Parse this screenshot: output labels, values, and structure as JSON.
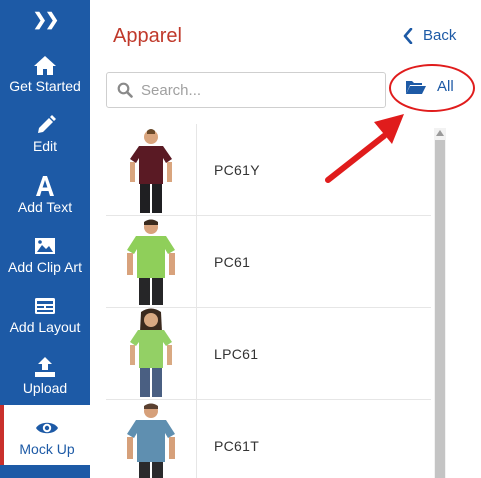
{
  "sidebar": {
    "items": [
      {
        "label": "Get Started",
        "icon": "home-icon"
      },
      {
        "label": "Edit",
        "icon": "pencil-icon"
      },
      {
        "label": "Add Text",
        "icon": "text-a-icon"
      },
      {
        "label": "Add Clip Art",
        "icon": "image-icon"
      },
      {
        "label": "Add Layout",
        "icon": "layout-icon"
      },
      {
        "label": "Upload",
        "icon": "upload-icon"
      },
      {
        "label": "Mock Up",
        "icon": "eye-icon"
      }
    ],
    "active_index": 6,
    "bg_color": "#1d5aa6",
    "active_accent": "#c9302c"
  },
  "header": {
    "title": "Apparel",
    "back_label": "Back"
  },
  "search": {
    "placeholder": "Search..."
  },
  "filter": {
    "label": "All"
  },
  "products": [
    {
      "code": "PC61Y",
      "shirt_color": "#5a1a24"
    },
    {
      "code": "PC61",
      "shirt_color": "#8fcf5a"
    },
    {
      "code": "LPC61",
      "shirt_color": "#93d065"
    },
    {
      "code": "PC61T",
      "shirt_color": "#5f8fb0"
    }
  ],
  "annotation_color": "#e01c1c"
}
